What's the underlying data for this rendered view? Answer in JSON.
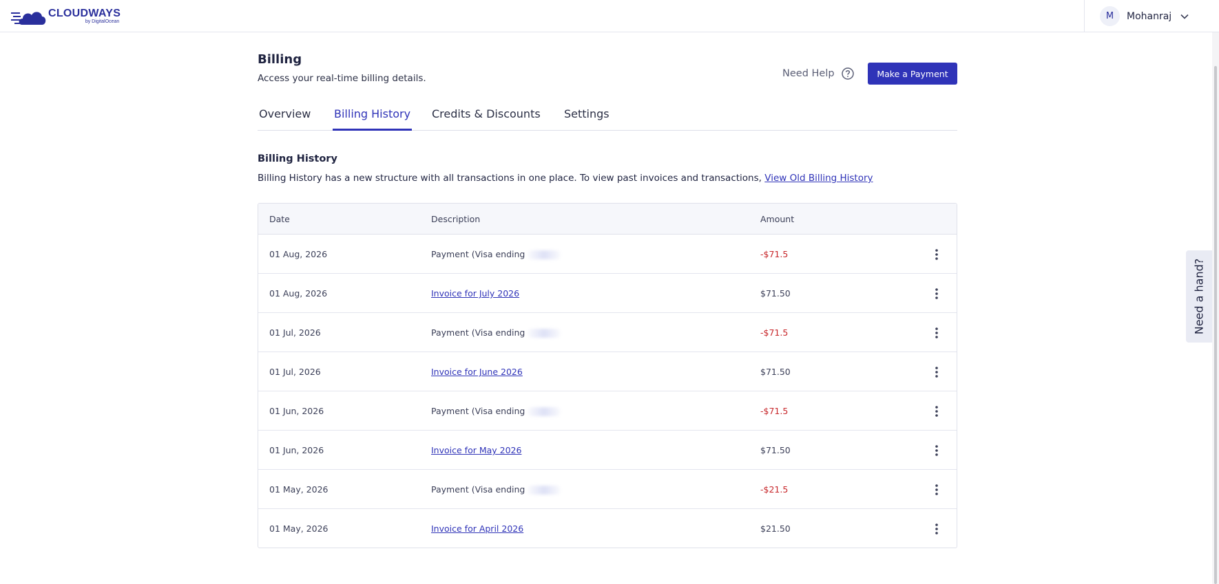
{
  "header": {
    "brand": "CLOUDWAYS",
    "brand_sub": "by DigitalOcean",
    "user_initial": "M",
    "user_name": "Mohanraj"
  },
  "page": {
    "title": "Billing",
    "subtitle": "Access your real-time billing details.",
    "need_help": "Need Help",
    "make_payment": "Make a Payment"
  },
  "tabs": [
    {
      "label": "Overview",
      "active": false
    },
    {
      "label": "Billing History",
      "active": true
    },
    {
      "label": "Credits & Discounts",
      "active": false
    },
    {
      "label": "Settings",
      "active": false
    }
  ],
  "section": {
    "title": "Billing History",
    "description": "Billing History has a new structure with all transactions in one place. To view past invoices and transactions,",
    "link": "View Old Billing History"
  },
  "table": {
    "columns": [
      "Date",
      "Description",
      "Amount"
    ],
    "rows": [
      {
        "date": "01 Aug, 2026",
        "description": "Payment (Visa ending",
        "amount": "-$71.5"
      },
      {
        "date": "01 Aug, 2026",
        "description": "Invoice for July 2026",
        "amount": "$71.50"
      },
      {
        "date": "01 Jul, 2026",
        "description": "Payment (Visa ending",
        "amount": "-$71.5"
      },
      {
        "date": "01 Jul, 2026",
        "description": "Invoice for June 2026",
        "amount": "$71.50"
      },
      {
        "date": "01 Jun, 2026",
        "description": "Payment (Visa ending",
        "amount": "-$71.5"
      },
      {
        "date": "01 Jun, 2026",
        "description": "Invoice for May 2026",
        "amount": "$71.50"
      },
      {
        "date": "01 May, 2026",
        "description": "Payment (Visa ending",
        "amount": "-$21.5"
      },
      {
        "date": "01 May, 2026",
        "description": "Invoice for April 2026",
        "amount": "$21.50"
      }
    ]
  },
  "need_a_hand": "Need a hand?",
  "colors": {
    "brand": "#2a2f9c",
    "accent": "#2f33b8",
    "negative": "#c7262a"
  }
}
